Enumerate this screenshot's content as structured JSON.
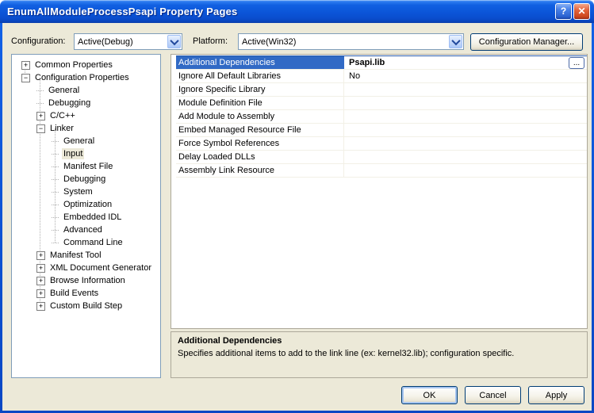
{
  "window": {
    "title": "EnumAllModuleProcessPsapi Property Pages",
    "help_glyph": "?",
    "close_glyph": "✕"
  },
  "toolbar": {
    "configuration_label": "Configuration:",
    "configuration_value": "Active(Debug)",
    "platform_label": "Platform:",
    "platform_value": "Active(Win32)",
    "config_manager_label": "Configuration Manager..."
  },
  "tree": {
    "items": [
      {
        "label": "Common Properties",
        "level": 0,
        "expander": "+"
      },
      {
        "label": "Configuration Properties",
        "level": 0,
        "expander": "-"
      },
      {
        "label": "General",
        "level": 1,
        "expander": ""
      },
      {
        "label": "Debugging",
        "level": 1,
        "expander": ""
      },
      {
        "label": "C/C++",
        "level": 1,
        "expander": "+"
      },
      {
        "label": "Linker",
        "level": 1,
        "expander": "-"
      },
      {
        "label": "General",
        "level": 2,
        "expander": ""
      },
      {
        "label": "Input",
        "level": 2,
        "expander": "",
        "selected": true
      },
      {
        "label": "Manifest File",
        "level": 2,
        "expander": ""
      },
      {
        "label": "Debugging",
        "level": 2,
        "expander": ""
      },
      {
        "label": "System",
        "level": 2,
        "expander": ""
      },
      {
        "label": "Optimization",
        "level": 2,
        "expander": ""
      },
      {
        "label": "Embedded IDL",
        "level": 2,
        "expander": ""
      },
      {
        "label": "Advanced",
        "level": 2,
        "expander": ""
      },
      {
        "label": "Command Line",
        "level": 2,
        "expander": ""
      },
      {
        "label": "Manifest Tool",
        "level": 1,
        "expander": "+"
      },
      {
        "label": "XML Document Generator",
        "level": 1,
        "expander": "+"
      },
      {
        "label": "Browse Information",
        "level": 1,
        "expander": "+"
      },
      {
        "label": "Build Events",
        "level": 1,
        "expander": "+"
      },
      {
        "label": "Custom Build Step",
        "level": 1,
        "expander": "+"
      }
    ]
  },
  "property_grid": {
    "rows": [
      {
        "name": "Additional Dependencies",
        "value": "Psapi.lib",
        "selected": true,
        "ellipsis": "..."
      },
      {
        "name": "Ignore All Default Libraries",
        "value": "No"
      },
      {
        "name": "Ignore Specific Library",
        "value": ""
      },
      {
        "name": "Module Definition File",
        "value": ""
      },
      {
        "name": "Add Module to Assembly",
        "value": ""
      },
      {
        "name": "Embed Managed Resource File",
        "value": ""
      },
      {
        "name": "Force Symbol References",
        "value": ""
      },
      {
        "name": "Delay Loaded DLLs",
        "value": ""
      },
      {
        "name": "Assembly Link Resource",
        "value": ""
      }
    ]
  },
  "description": {
    "title": "Additional Dependencies",
    "text": "Specifies additional items to add to the link line (ex: kernel32.lib); configuration specific."
  },
  "footer": {
    "ok_label": "OK",
    "cancel_label": "Cancel",
    "apply_label": "Apply"
  },
  "colors": {
    "selection_blue": "#316AC5",
    "titlebar_blue": "#0B55D8",
    "dialog_bg": "#ECE9D8",
    "inactive_selection": "#ECE9D8"
  }
}
